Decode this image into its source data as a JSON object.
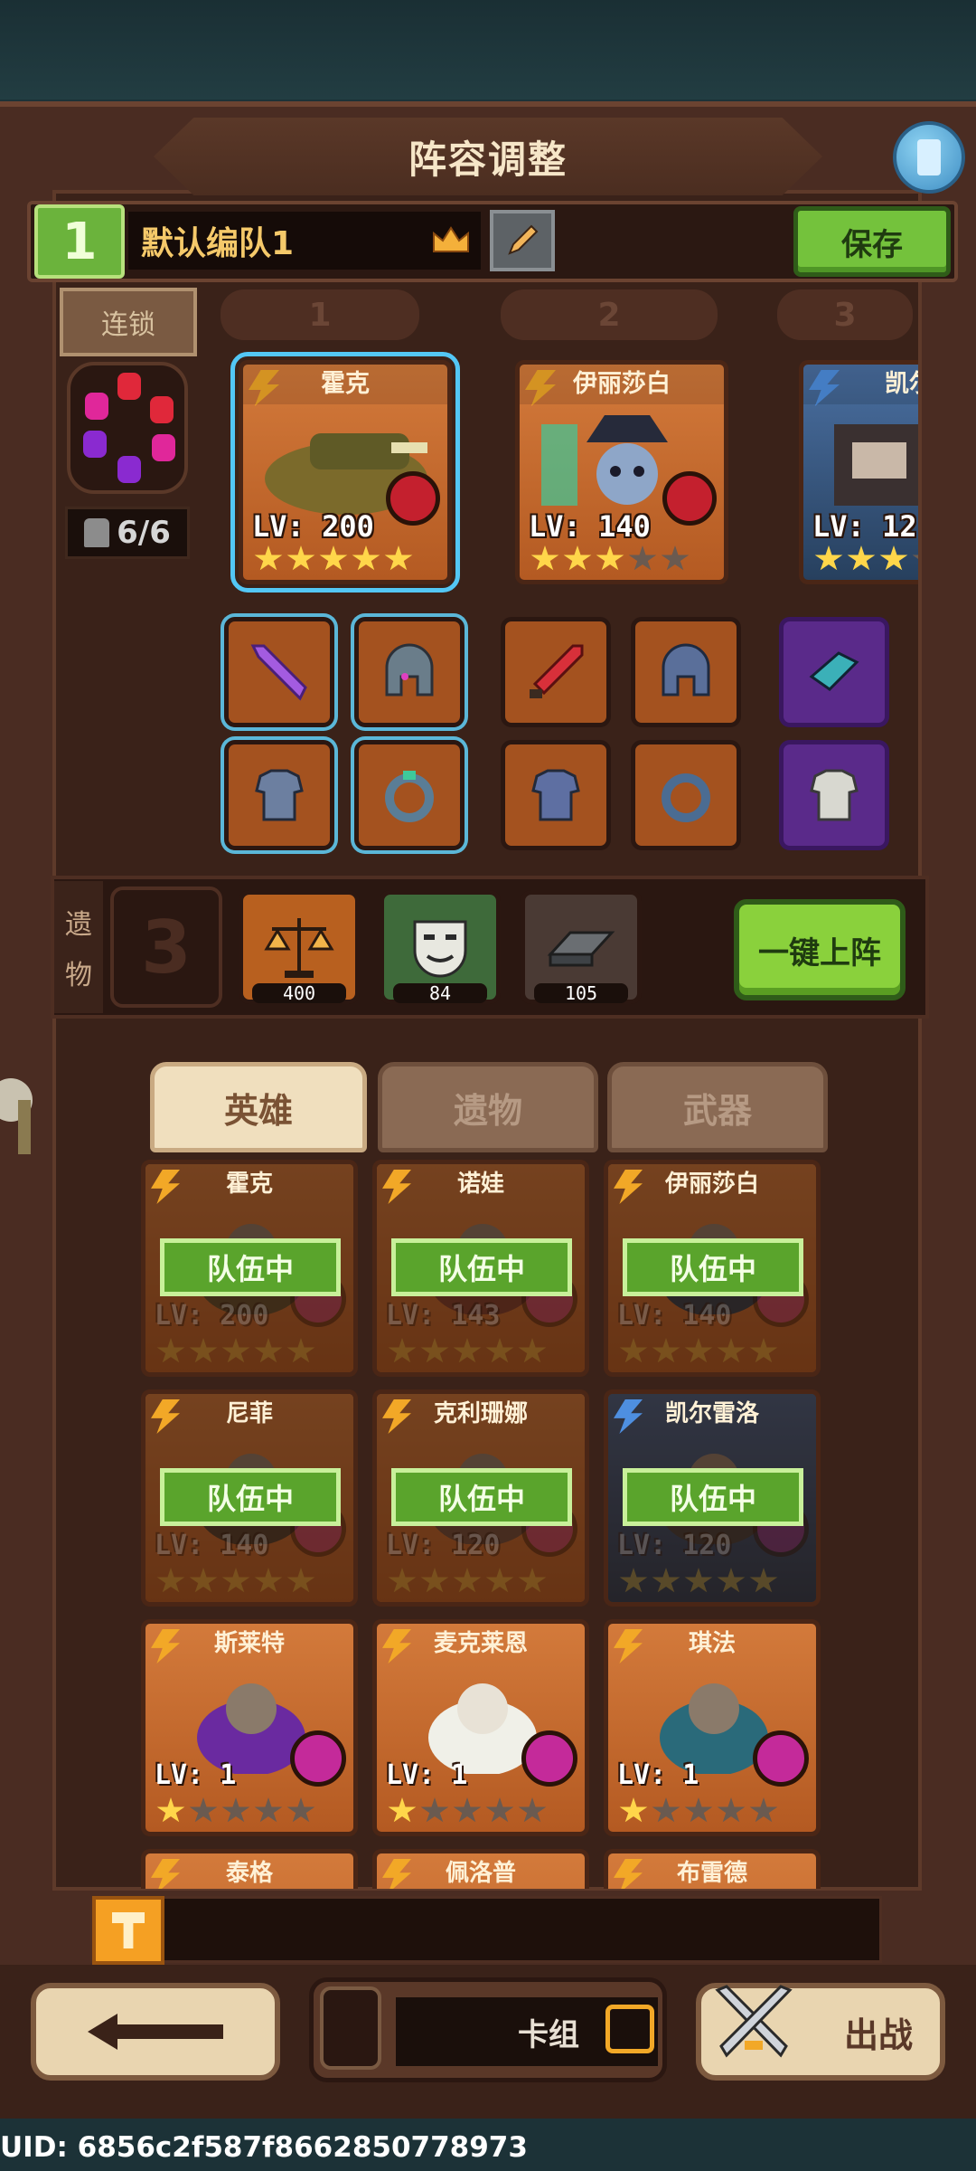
{
  "header": {
    "title": "阵容调整"
  },
  "team": {
    "number": "1",
    "name": "默认编队1",
    "save_label": "保存"
  },
  "chain": {
    "label": "连锁",
    "count": "6/6"
  },
  "slot_tabs": [
    "1",
    "2",
    "3"
  ],
  "lineup": [
    {
      "name": "霍克",
      "level": "LV: 200",
      "stars": 5,
      "frame": "orange"
    },
    {
      "name": "伊丽莎白",
      "level": "LV: 140",
      "stars": 3,
      "frame": "orange"
    },
    {
      "name": "凯尔",
      "level": "LV: 12",
      "stars": 3,
      "frame": "blue"
    }
  ],
  "relics": {
    "label_top": "遗",
    "label_bottom": "物",
    "slot_number": "3",
    "items": [
      {
        "icon": "scales-icon",
        "value": "400"
      },
      {
        "icon": "mask-icon",
        "value": "84"
      },
      {
        "icon": "ingot-icon",
        "value": "105"
      }
    ],
    "auto_button": "一键上阵"
  },
  "tabs": {
    "heroes": "英雄",
    "relics": "遗物",
    "weapons": "武器"
  },
  "in_team_label": "队伍中",
  "heroes": [
    {
      "name": "霍克",
      "level": "LV: 200",
      "stars": 5,
      "frame": "orange",
      "in_team": true
    },
    {
      "name": "诺娃",
      "level": "LV: 143",
      "stars": 5,
      "frame": "orange",
      "in_team": true
    },
    {
      "name": "伊丽莎白",
      "level": "LV: 140",
      "stars": 5,
      "frame": "orange",
      "in_team": true
    },
    {
      "name": "尼菲",
      "level": "LV: 140",
      "stars": 5,
      "frame": "orange",
      "in_team": true
    },
    {
      "name": "克利珊娜",
      "level": "LV: 120",
      "stars": 5,
      "frame": "orange",
      "in_team": true
    },
    {
      "name": "凯尔雷洛",
      "level": "LV: 120",
      "stars": 5,
      "frame": "blue",
      "in_team": true
    },
    {
      "name": "斯莱特",
      "level": "LV: 1",
      "stars": 1,
      "frame": "orange",
      "in_team": false
    },
    {
      "name": "麦克莱恩",
      "level": "LV: 1",
      "stars": 1,
      "frame": "orange",
      "in_team": false
    },
    {
      "name": "琪法",
      "level": "LV: 1",
      "stars": 1,
      "frame": "orange",
      "in_team": false
    },
    {
      "name": "泰格",
      "level": "",
      "stars": 0,
      "frame": "orange",
      "in_team": false
    },
    {
      "name": "佩洛普",
      "level": "",
      "stars": 0,
      "frame": "orange",
      "in_team": false
    },
    {
      "name": "布雷德",
      "level": "",
      "stars": 0,
      "frame": "orange",
      "in_team": false
    }
  ],
  "footer": {
    "deck_label": "卡组",
    "battle_label": "出战"
  },
  "uid": "UID: 6856c2f587f8662850778973",
  "colors": {
    "accent_green": "#74c23c",
    "selection_blue": "#53c7f5",
    "card_orange": "#c8692c",
    "card_blue": "#3d5f8b"
  }
}
